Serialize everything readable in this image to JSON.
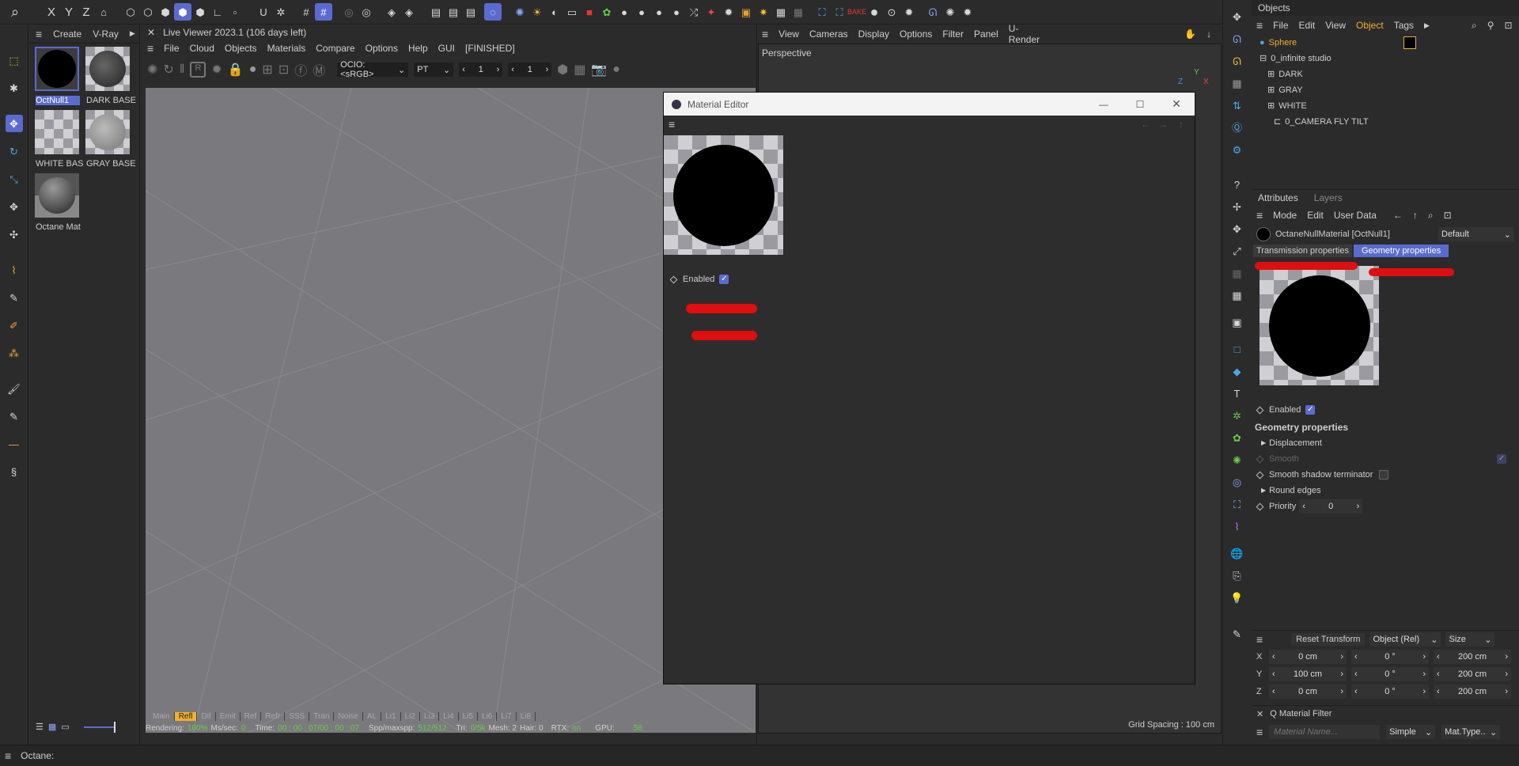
{
  "left_tools": {
    "axes": [
      "X",
      "Y",
      "Z"
    ]
  },
  "material_manager": {
    "menu": [
      "Create",
      "V-Ray"
    ],
    "materials": [
      "OctNull1",
      "DARK BASE",
      "WHITE BAS",
      "GRAY BASE",
      "Octane Mat"
    ]
  },
  "live_viewer": {
    "title": "Live Viewer 2023.1 (106 days left)",
    "menu": [
      "File",
      "Cloud",
      "Objects",
      "Materials",
      "Compare",
      "Options",
      "Help",
      "GUI",
      "[FINISHED]"
    ],
    "ocio": "OCIO:<sRGB>",
    "mode": "PT",
    "val1": "1",
    "val2": "1",
    "channels": [
      "Main",
      "Refl",
      "Dif",
      "Emit",
      "Ref",
      "Refr",
      "SSS",
      "Tran",
      "Noise",
      "AL",
      "Li1",
      "Li2",
      "Li3",
      "Li4",
      "Li5",
      "Li6",
      "Li7",
      "Li8"
    ],
    "status": {
      "rendering_label": "Rendering:",
      "rendering_val": "100%",
      "mssec_label": "Ms/sec:",
      "mssec_val": "0",
      "time_label": "Time:",
      "time_val": "00 : 00 : 07/00 : 00 : 07",
      "spp_label": "Spp/maxspp:",
      "spp_val": "512/512",
      "tri_label": "Tri:",
      "tri_val": "0/5k",
      "mesh": "Mesh: 2",
      "hair": "Hair: 0",
      "rtx_label": "RTX:",
      "rtx_val": "on",
      "gpu_label": "GPU:",
      "gpu_val": "56"
    }
  },
  "viewport": {
    "menu": [
      "View",
      "Cameras",
      "Display",
      "Options",
      "Filter",
      "Panel",
      "U-Render"
    ],
    "label": "Perspective",
    "grid_spacing": "Grid Spacing : 100 cm",
    "axes": [
      "Y",
      "Z",
      "X"
    ]
  },
  "material_editor": {
    "title": "Material Editor",
    "enabled_label": "Enabled"
  },
  "objects": {
    "title": "Objects",
    "menu": [
      "File",
      "Edit",
      "View",
      "Object",
      "Tags"
    ],
    "tree": [
      "Sphere",
      "0_infinite studio",
      "DARK",
      "GRAY",
      "WHITE",
      "0_CAMERA FLY TILT"
    ]
  },
  "attributes": {
    "tabs": [
      "Attributes",
      "Layers"
    ],
    "menu": [
      "Mode",
      "Edit",
      "User Data"
    ],
    "material_name": "OctaneNullMaterial [OctNull1]",
    "preset": "Default",
    "prop_tabs": [
      "Transmission properties",
      "Geometry properties"
    ],
    "enabled": "Enabled",
    "section": "Geometry properties",
    "displacement": "Displacement",
    "smooth": "Smooth",
    "smooth_shadow": "Smooth shadow terminator",
    "round_edges": "Round edges",
    "priority_label": "Priority",
    "priority_val": "0"
  },
  "coords": {
    "reset": "Reset Transform",
    "mode": "Object (Rel)",
    "size": "Size",
    "rows": [
      {
        "axis": "X",
        "a": "0 cm",
        "b": "0 °",
        "c": "200 cm"
      },
      {
        "axis": "Y",
        "a": "100 cm",
        "b": "0 °",
        "c": "200 cm"
      },
      {
        "axis": "Z",
        "a": "0 cm",
        "b": "0 °",
        "c": "200 cm"
      }
    ]
  },
  "filter": {
    "title": "Q Material Filter",
    "placeholder": "Material Name...",
    "mode": "Simple",
    "type": "Mat.Type.."
  },
  "bottom": {
    "status": "Octane:"
  },
  "colors": {
    "accent": "#5a6bd0",
    "annotation": "#e00e0e",
    "selected": "#f0b030"
  }
}
